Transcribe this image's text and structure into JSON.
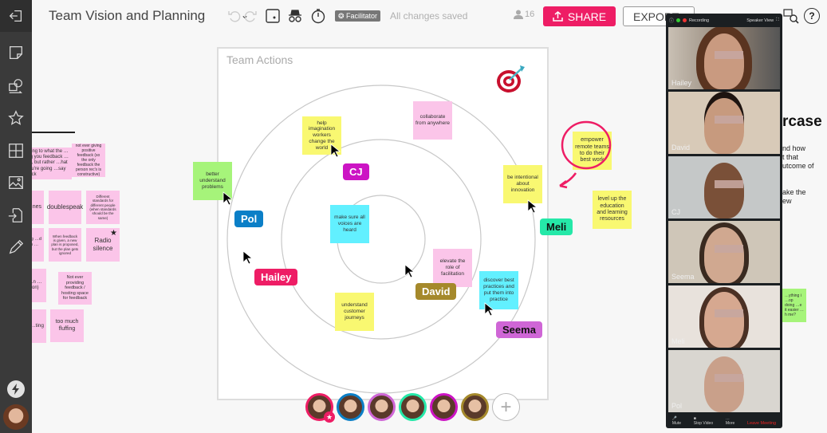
{
  "header": {
    "title": "Team Vision and Planning",
    "facilitator_label": "Facilitator",
    "save_status": "All changes saved",
    "user_count": "16",
    "share_label": "SHARE",
    "export_label": "EXPORT",
    "help_label": "?"
  },
  "sidebar": {
    "icons": [
      "exit-icon",
      "sticky-note-icon",
      "shapes-icon",
      "star-icon",
      "grid-icon",
      "image-icon",
      "import-icon",
      "pen-icon"
    ]
  },
  "board": {
    "title": "Team Actions",
    "stickies": [
      {
        "text": "help imagination workers change the world",
        "color": "yellow"
      },
      {
        "text": "collaborate from anywhere",
        "color": "pink"
      },
      {
        "text": "better understand problems",
        "color": "green"
      },
      {
        "text": "be intentional about innovation",
        "color": "yellow"
      },
      {
        "text": "make sure all voices are heard",
        "color": "cyan"
      },
      {
        "text": "elevate the role of facilitation",
        "color": "pink"
      },
      {
        "text": "discover best practices and put them into practice",
        "color": "cyan"
      },
      {
        "text": "understand customer journeys",
        "color": "yellow"
      },
      {
        "text": "empower remote teams to do their best work",
        "color": "yellow"
      },
      {
        "text": "level up the education and learning resources",
        "color": "yellow"
      }
    ],
    "cursors": [
      {
        "name": "CJ",
        "color": "#cc14c4"
      },
      {
        "name": "Pol",
        "color": "#0b7fc7"
      },
      {
        "name": "Hailey",
        "color": "#ee1d65"
      },
      {
        "name": "David",
        "color": "#a5892b"
      },
      {
        "name": "Seema",
        "color": "#cf66d6"
      },
      {
        "name": "Meli",
        "color": "#25e8a8"
      }
    ]
  },
  "left_stickies": [
    {
      "text": "…ing to what the …ing you feedback …ng, but rather …hat you're going …say back"
    },
    {
      "text": "not ever giving positive feedback (so the only feedback the person rec's is constructive)"
    },
    {
      "text": "…nes"
    },
    {
      "text": "doublespeak"
    },
    {
      "text": "Different standards for different people (when standards should be the same)"
    },
    {
      "text": "…ng …cing …d or …upon …ons"
    },
    {
      "text": "When feedback is given, a new plan is proposed, but the plan gets ignored"
    },
    {
      "text": "Radio silence"
    },
    {
      "text": "…nally …n …ck or …on)"
    },
    {
      "text": "Not ever providing feedback / hosting space for feedback"
    },
    {
      "text": "…re of …ting"
    },
    {
      "text": "too much fluffing"
    }
  ],
  "right_doc": {
    "heading": "rcase",
    "lines": [
      "nd how",
      "t that",
      "utcome of",
      "",
      "ake the",
      "ew"
    ],
    "sticky": "…ything i …op doing …e it easier …h me?"
  },
  "participants": [
    {
      "name": "Hailey",
      "color": "#ee1d65",
      "is_facilitator": true
    },
    {
      "name": "Pol",
      "color": "#0b7fc7"
    },
    {
      "name": "Seema",
      "color": "#cf66d6"
    },
    {
      "name": "Meli",
      "color": "#25e8a8"
    },
    {
      "name": "CJ",
      "color": "#cc14c4"
    },
    {
      "name": "David",
      "color": "#a5892b"
    }
  ],
  "video_call": {
    "recording_label": "Recording",
    "view_label": "Speaker View",
    "tiles": [
      "Hailey",
      "David",
      "CJ",
      "Seema",
      "Meli",
      "Pol"
    ],
    "controls": {
      "mute": "Mute",
      "stop_video": "Stop Video",
      "more": "More",
      "leave": "Leave Meeting"
    }
  }
}
